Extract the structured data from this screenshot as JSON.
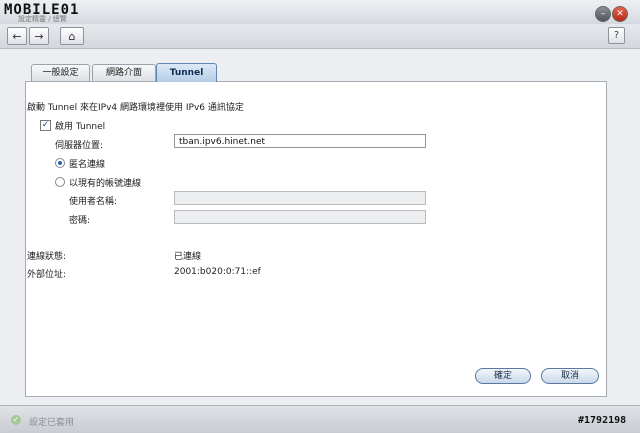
{
  "window": {
    "logo": "MOBILE01",
    "logo_sub": "設定精靈 / 總覽",
    "minimize_icon": "minimize-icon",
    "close_icon": "close-icon"
  },
  "toolbar": {
    "back_icon": "←",
    "forward_icon": "→",
    "home_icon": "⌂",
    "help_label": "?"
  },
  "tabs": [
    {
      "label": "一般設定"
    },
    {
      "label": "網路介面"
    },
    {
      "label": "Tunnel"
    }
  ],
  "tunnel": {
    "description": "啟動 Tunnel 來在IPv4 網路環境裡使用 IPv6 通訊協定",
    "enable_label": "啟用 Tunnel",
    "server_label": "伺服器位置:",
    "server_value": "tban.ipv6.hinet.net",
    "anonymous_label": "匿名連線",
    "account_label": "以現有的帳號連線",
    "username_label": "使用者名稱:",
    "password_label": "密碼:",
    "username_value": "",
    "password_value": "",
    "status_label": "連線狀態:",
    "status_value": "已連線",
    "external_label": "外部位址:",
    "external_value": "2001:b020:0:71::ef"
  },
  "buttons": {
    "ok": "確定",
    "cancel": "取消"
  },
  "statusbar": {
    "text": "設定已套用"
  },
  "watermark": "#1792198"
}
